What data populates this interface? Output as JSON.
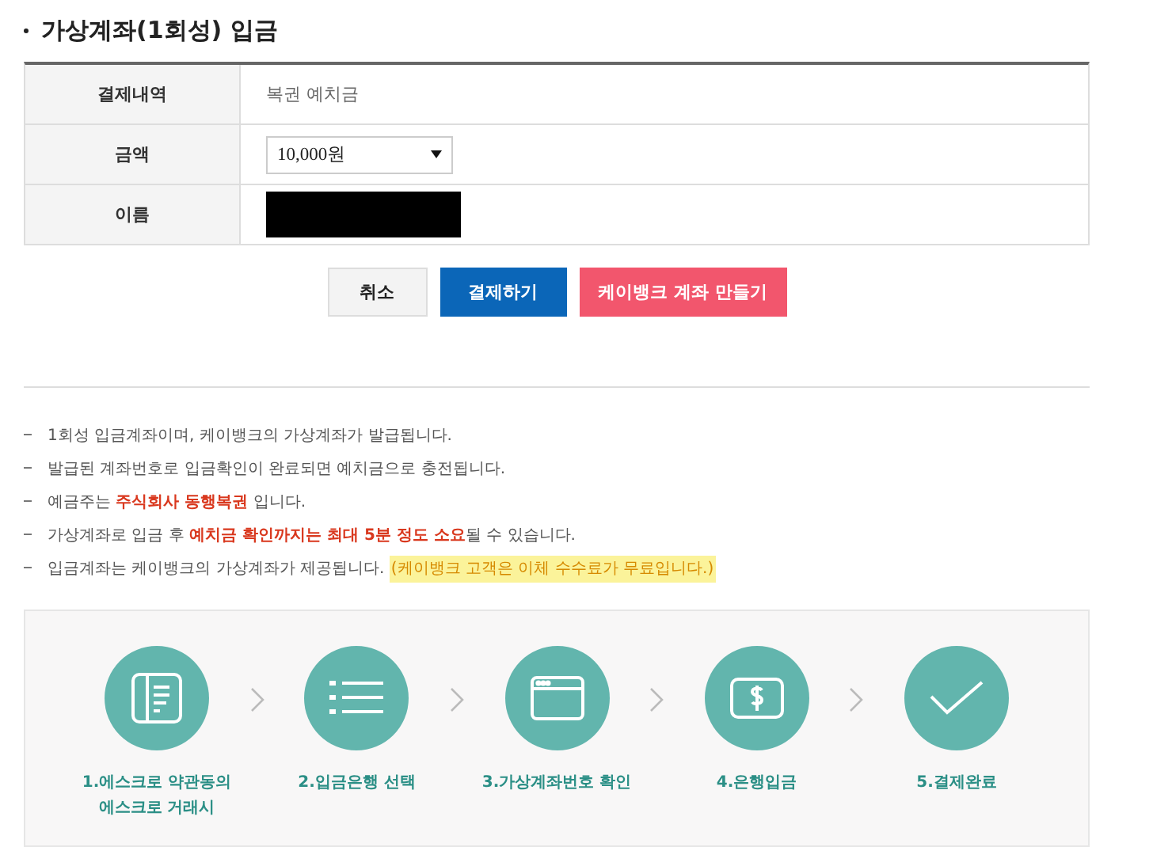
{
  "title": "가상계좌(1회성) 입금",
  "form_rows": [
    {
      "kind": "text",
      "label": "결제내역",
      "value": "복권 예치금"
    },
    {
      "kind": "select",
      "label": "금액",
      "value": "10,000원"
    },
    {
      "kind": "redacted",
      "label": "이름"
    }
  ],
  "buttons": [
    {
      "kind": "plain",
      "label": "취소"
    },
    {
      "kind": "primary",
      "label": "결제하기"
    },
    {
      "kind": "accent",
      "label": "케이뱅크 계좌 만들기"
    }
  ],
  "notes": [
    {
      "text": "1회성 입금계좌이며, 케이뱅크의 가상계좌가 발급됩니다."
    },
    {
      "text": "발급된 계좌번호로 입금확인이 완료되면 예치금으로 충전됩니다."
    },
    {
      "text": "예금주는 **주식회사 동행복권** 입니다."
    },
    {
      "text": "가상계좌로 입금 후 **예치금 확인까지는 최대 5분 정도 소요**될 수 있습니다."
    },
    {
      "text": "입금계좌는 케이뱅크의 가상계좌가 제공됩니다.",
      "highlight": "(케이뱅크 고객은 이체 수수료가 무료입니다.)"
    }
  ],
  "steps": [
    {
      "kind": "document",
      "label": "1.에스크로 약관동의\n에스크로 거래시"
    },
    {
      "kind": "list",
      "label": "2.입금은행 선택"
    },
    {
      "kind": "window",
      "label": "3.가상계좌번호 확인"
    },
    {
      "kind": "money",
      "label": "4.은행입금"
    },
    {
      "kind": "check",
      "label": "5.결제완료"
    }
  ]
}
